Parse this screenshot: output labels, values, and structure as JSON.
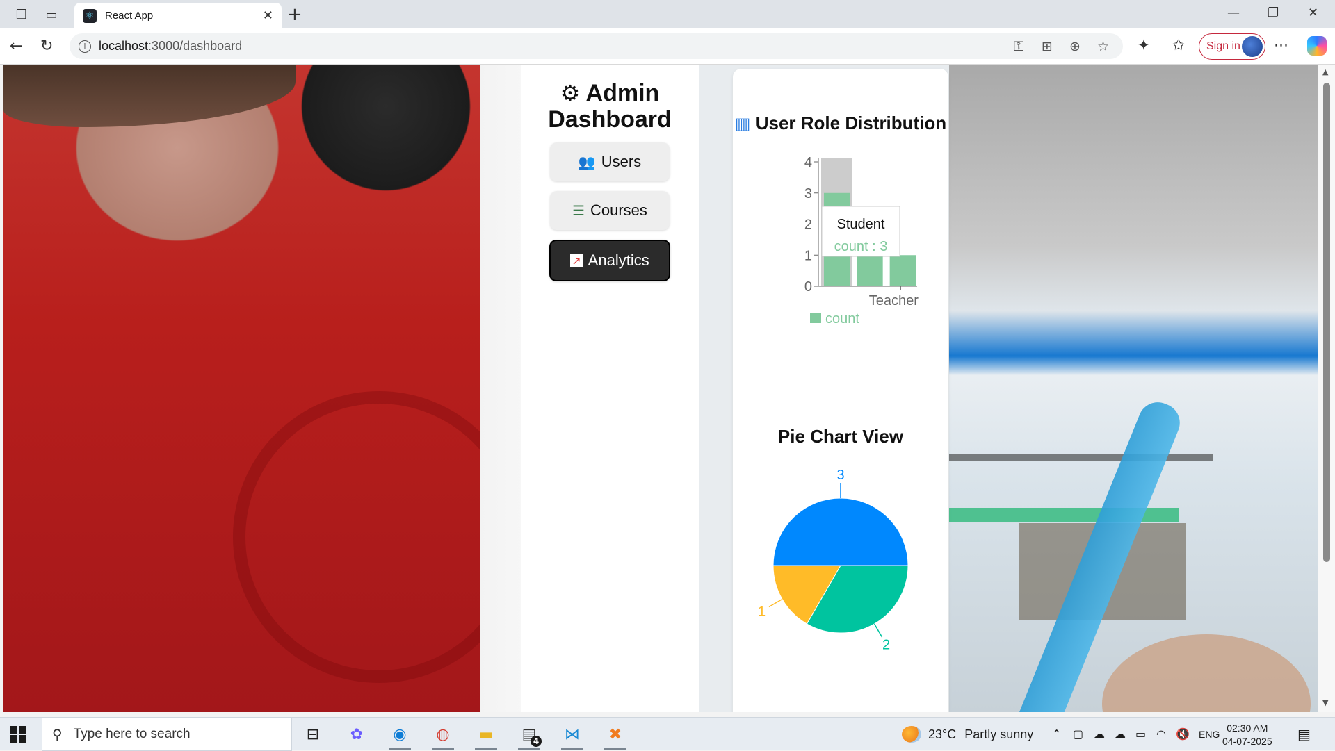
{
  "browser": {
    "tab_title": "React App",
    "url_host": "localhost",
    "url_path": ":3000/dashboard",
    "sign_in_label": "Sign in"
  },
  "sidebar": {
    "title": "Admin Dashboard",
    "items": [
      {
        "label": "Users",
        "icon": "users-icon",
        "active": false
      },
      {
        "label": "Courses",
        "icon": "books-icon",
        "active": false
      },
      {
        "label": "Analytics",
        "icon": "chart-increasing-icon",
        "active": true
      }
    ]
  },
  "analytics": {
    "bar_title": "User Role Distribution",
    "pie_title": "Pie Chart View"
  },
  "chart_data": [
    {
      "type": "bar",
      "title": "User Role Distribution",
      "categories": [
        "Student",
        "",
        "Teacher"
      ],
      "series": [
        {
          "name": "count",
          "values": [
            3,
            1,
            1
          ],
          "color": "#82ca9d"
        }
      ],
      "ylim": [
        0,
        4
      ],
      "yticks": [
        0,
        1,
        2,
        3,
        4
      ],
      "xtick_labels_visible": [
        "Teacher"
      ],
      "legend": "bottom",
      "tooltip": {
        "category": "Student",
        "label": "count : 3"
      },
      "grid": false
    },
    {
      "type": "pie",
      "title": "Pie Chart View",
      "slices": [
        {
          "value": 3,
          "color": "#0088fe",
          "label": "3"
        },
        {
          "value": 1,
          "color": "#ffbb28",
          "label": "1"
        },
        {
          "value": 2,
          "color": "#00c49f",
          "label": "2"
        }
      ]
    }
  ],
  "taskbar": {
    "search_placeholder": "Type here to search",
    "weather_temp": "23°C",
    "weather_text": "Partly sunny",
    "language": "ENG",
    "time": "02:30 AM",
    "date": "04-07-2025",
    "badge_count": "4"
  },
  "colors": {
    "active_nav": "#2b2b2b",
    "bar": "#82ca9d",
    "pie_blue": "#0088fe",
    "pie_green": "#00c49f",
    "pie_yellow": "#ffbb28",
    "signin_accent": "#c5283d"
  }
}
